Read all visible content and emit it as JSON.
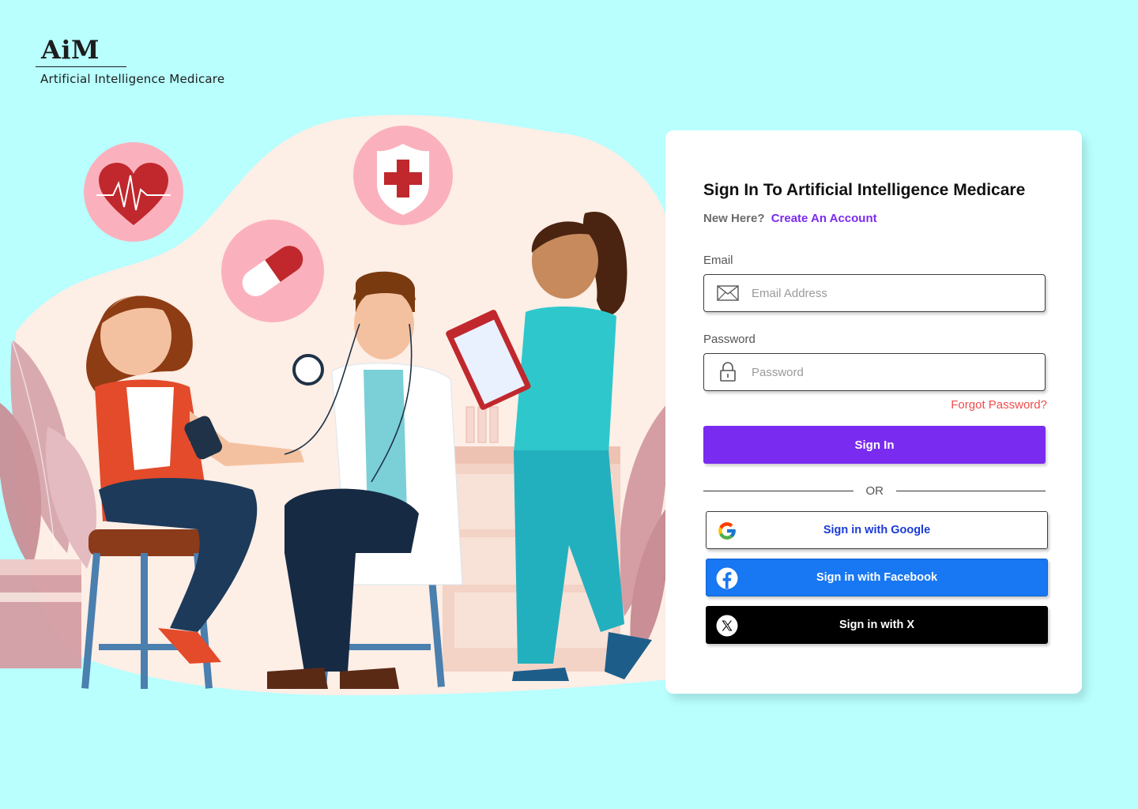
{
  "brand": {
    "logo": "AiM",
    "tagline": "Artificial Intelligence Medicare"
  },
  "illustration": {
    "icons": [
      "heart-rate-icon",
      "medical-shield-icon",
      "pill-capsule-icon"
    ]
  },
  "signin": {
    "title": "Sign In To Artificial Intelligence Medicare",
    "new_here": "New Here?",
    "create_account": "Create An Account",
    "email_label": "Email",
    "email_placeholder": "Email Address",
    "password_label": "Password",
    "password_placeholder": "Password",
    "forgot": "Forgot Password?",
    "submit": "Sign In",
    "or": "OR",
    "google": "Sign in with Google",
    "facebook": "Sign in with Facebook",
    "x": "Sign in with X"
  },
  "colors": {
    "background": "#b8fffe",
    "accent": "#7a2bf0",
    "danger": "#ef4b4b",
    "facebook": "#1877f2",
    "x": "#000000"
  }
}
